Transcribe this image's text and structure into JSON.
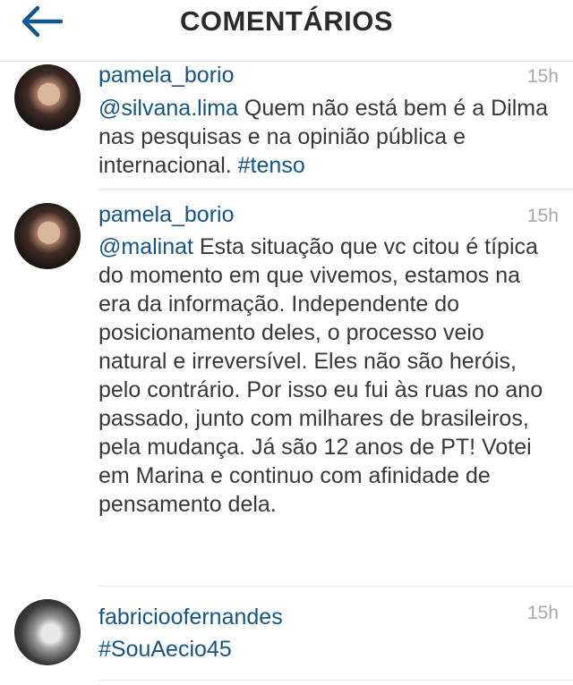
{
  "header": {
    "title": "COMENTÁRIOS",
    "back_icon": "arrow-left-icon",
    "accent_color": "#125688"
  },
  "comments": [
    {
      "username": "pamela_borio",
      "time": "15h",
      "mention": "@silvana.lima",
      "text": " Quem não está bem é a Dilma nas pesquisas e na opinião pública e internacional. ",
      "hashtag": "#tenso"
    },
    {
      "username": "pamela_borio",
      "time": "15h",
      "mention": "@malinat",
      "text": " Esta situação que vc citou é típica do momento em que vivemos, estamos na era da informação. Independente do posicionamento deles, o processo veio natural e irreversível. Eles não são heróis, pelo contrário. Por isso eu fui às ruas no ano passado, junto com milhares de brasileiros, pela mudança. Já são 12 anos de PT! Votei em Marina e continuo com afinidade de pensamento dela."
    },
    {
      "username": "fabricioofernandes",
      "time": "15h",
      "hashtag": "#SouAecio45"
    }
  ]
}
